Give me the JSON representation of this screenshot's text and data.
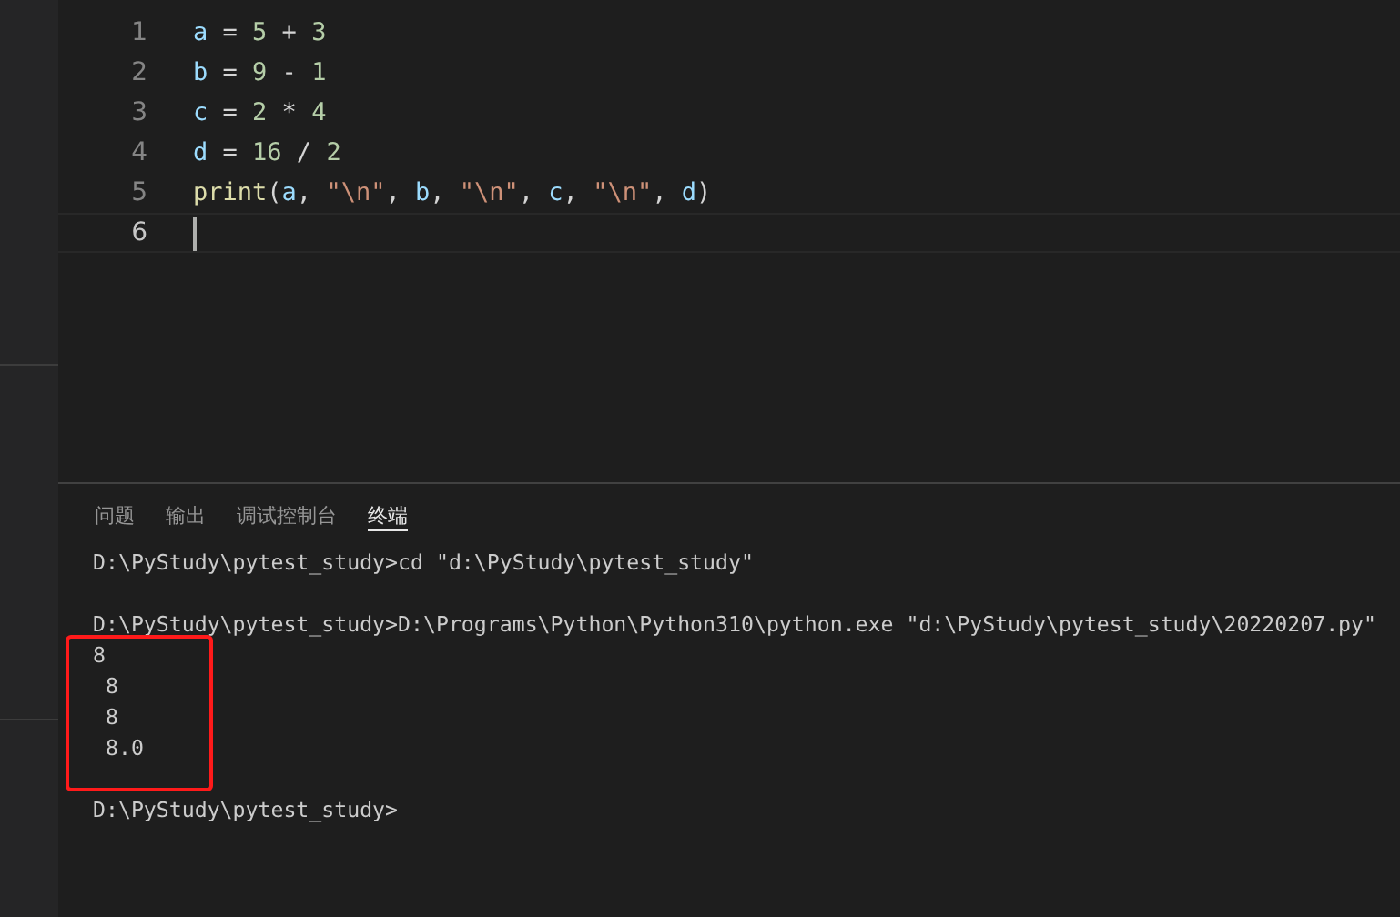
{
  "editor": {
    "lines": [
      {
        "number": "1",
        "active": false,
        "tokens": [
          {
            "kind": "var",
            "text": "a"
          },
          {
            "kind": "plain",
            "text": " = "
          },
          {
            "kind": "num",
            "text": "5"
          },
          {
            "kind": "plain",
            "text": " + "
          },
          {
            "kind": "num",
            "text": "3"
          }
        ]
      },
      {
        "number": "2",
        "active": false,
        "tokens": [
          {
            "kind": "var",
            "text": "b"
          },
          {
            "kind": "plain",
            "text": " = "
          },
          {
            "kind": "num",
            "text": "9"
          },
          {
            "kind": "plain",
            "text": " - "
          },
          {
            "kind": "num",
            "text": "1"
          }
        ]
      },
      {
        "number": "3",
        "active": false,
        "tokens": [
          {
            "kind": "var",
            "text": "c"
          },
          {
            "kind": "plain",
            "text": " = "
          },
          {
            "kind": "num",
            "text": "2"
          },
          {
            "kind": "plain",
            "text": " * "
          },
          {
            "kind": "num",
            "text": "4"
          }
        ]
      },
      {
        "number": "4",
        "active": false,
        "tokens": [
          {
            "kind": "var",
            "text": "d"
          },
          {
            "kind": "plain",
            "text": " = "
          },
          {
            "kind": "num",
            "text": "16"
          },
          {
            "kind": "plain",
            "text": " / "
          },
          {
            "kind": "num",
            "text": "2"
          }
        ]
      },
      {
        "number": "5",
        "active": false,
        "tokens": [
          {
            "kind": "func",
            "text": "print"
          },
          {
            "kind": "plain",
            "text": "("
          },
          {
            "kind": "var",
            "text": "a"
          },
          {
            "kind": "plain",
            "text": ", "
          },
          {
            "kind": "str",
            "text": "\"\\n\""
          },
          {
            "kind": "plain",
            "text": ", "
          },
          {
            "kind": "var",
            "text": "b"
          },
          {
            "kind": "plain",
            "text": ", "
          },
          {
            "kind": "str",
            "text": "\"\\n\""
          },
          {
            "kind": "plain",
            "text": ", "
          },
          {
            "kind": "var",
            "text": "c"
          },
          {
            "kind": "plain",
            "text": ", "
          },
          {
            "kind": "str",
            "text": "\"\\n\""
          },
          {
            "kind": "plain",
            "text": ", "
          },
          {
            "kind": "var",
            "text": "d"
          },
          {
            "kind": "plain",
            "text": ")"
          }
        ]
      },
      {
        "number": "6",
        "active": true
      }
    ]
  },
  "panel": {
    "tabs": [
      {
        "label": "问题",
        "selected": false
      },
      {
        "label": "输出",
        "selected": false
      },
      {
        "label": "调试控制台",
        "selected": false
      },
      {
        "label": "终端",
        "selected": true
      }
    ],
    "terminal": {
      "blocks": [
        [
          "D:\\PyStudy\\pytest_study>cd \"d:\\PyStudy\\pytest_study\""
        ],
        [
          "D:\\PyStudy\\pytest_study>D:\\Programs\\Python\\Python310\\python.exe \"d:\\PyStudy\\pytest_study\\20220207.py\"",
          "8",
          " 8",
          " 8",
          " 8.0"
        ],
        [
          "D:\\PyStudy\\pytest_study>"
        ]
      ]
    }
  }
}
